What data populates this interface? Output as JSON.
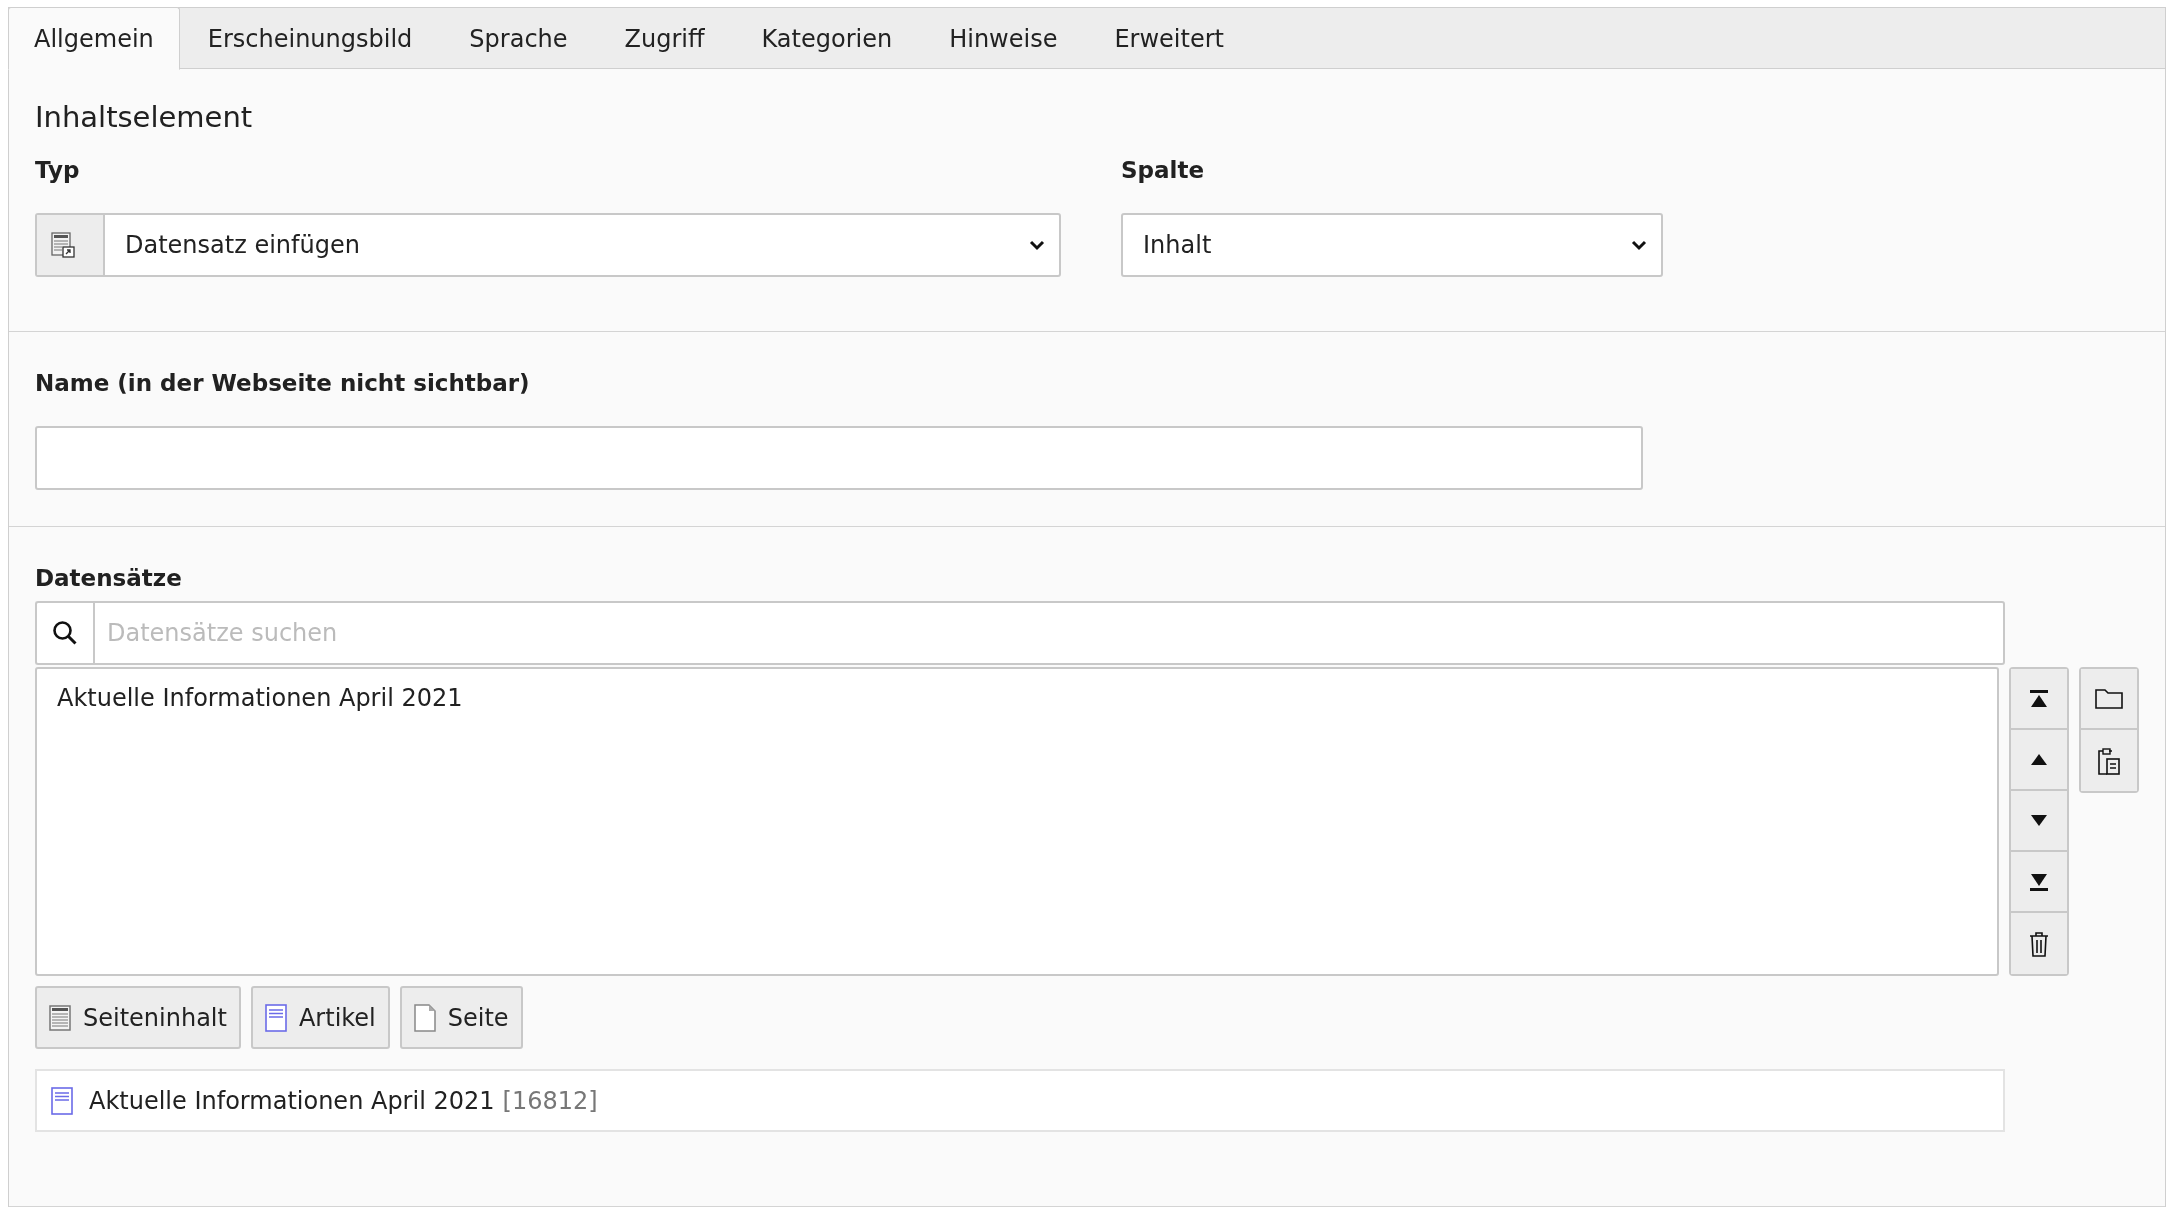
{
  "tabs": [
    {
      "label": "Allgemein",
      "selected": true
    },
    {
      "label": "Erscheinungsbild",
      "selected": false
    },
    {
      "label": "Sprache",
      "selected": false
    },
    {
      "label": "Zugriff",
      "selected": false
    },
    {
      "label": "Kategorien",
      "selected": false
    },
    {
      "label": "Hinweise",
      "selected": false
    },
    {
      "label": "Erweitert",
      "selected": false
    }
  ],
  "section_title": "Inhaltselement",
  "type_field": {
    "label": "Typ",
    "value": "Datensatz einfügen"
  },
  "column_field": {
    "label": "Spalte",
    "value": "Inhalt"
  },
  "name_field": {
    "label": "Name (in der Webseite nicht sichtbar)"
  },
  "records": {
    "label": "Datensätze",
    "search": {
      "placeholder": "Datensätze suchen"
    },
    "list_items": [
      "Aktuelle Informationen April 2021"
    ],
    "add_buttons": [
      {
        "kind": "content",
        "label": "Seiteninhalt"
      },
      {
        "kind": "article",
        "label": "Artikel"
      },
      {
        "kind": "page",
        "label": "Seite"
      }
    ],
    "selected_records": [
      {
        "kind": "article",
        "title": "Aktuelle Informationen April 2021",
        "id": "[16812]"
      }
    ]
  }
}
